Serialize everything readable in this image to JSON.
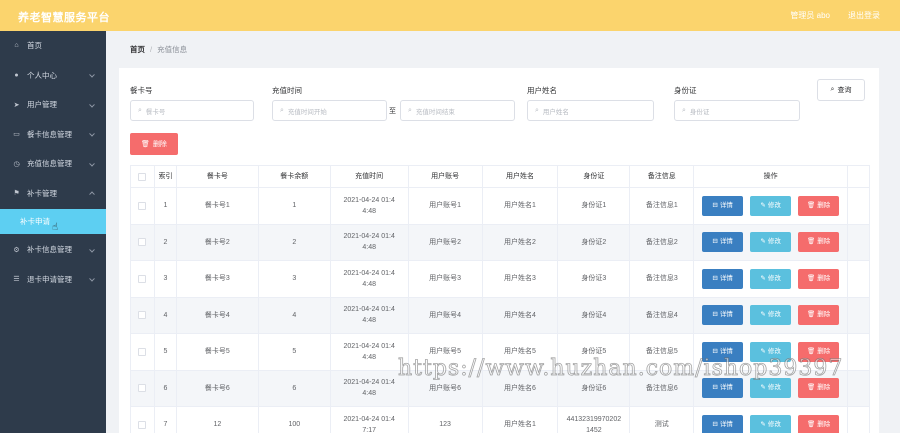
{
  "app": {
    "title": "养老智慧服务平台",
    "admin_label": "管理员 abo",
    "logout_label": "退出登录"
  },
  "sidebar": {
    "items": [
      {
        "label": "首页",
        "icon": "home-icon",
        "has_arrow": false
      },
      {
        "label": "个人中心",
        "icon": "user-icon",
        "has_arrow": true
      },
      {
        "label": "用户管理",
        "icon": "send-icon",
        "has_arrow": true
      },
      {
        "label": "餐卡信息管理",
        "icon": "card-icon",
        "has_arrow": true
      },
      {
        "label": "充值信息管理",
        "icon": "clock-icon",
        "has_arrow": true
      },
      {
        "label": "补卡管理",
        "icon": "flag-icon",
        "has_arrow": true,
        "expanded": true
      },
      {
        "label": "补卡信息管理",
        "icon": "gear-icon",
        "has_arrow": true
      },
      {
        "label": "退卡申请管理",
        "icon": "sliders-icon",
        "has_arrow": true
      }
    ],
    "active_subitem": "补卡申请"
  },
  "breadcrumb": {
    "home": "首页",
    "separator": "/",
    "current": "充值信息"
  },
  "search": {
    "card_label": "餐卡号",
    "card_placeholder": "餐卡号",
    "time_label": "充值时间",
    "time_start_placeholder": "充值时间开始",
    "time_to": "至",
    "time_end_placeholder": "充值时间结束",
    "name_label": "用户姓名",
    "name_placeholder": "用户姓名",
    "id_label": "身份证",
    "id_placeholder": "身份证",
    "query_label": "查询"
  },
  "actions": {
    "delete_label": "删除"
  },
  "table": {
    "headers": [
      "索引",
      "餐卡号",
      "餐卡余额",
      "充值时间",
      "用户账号",
      "用户姓名",
      "身份证",
      "备注信息",
      "操作"
    ],
    "rows": [
      {
        "index": "1",
        "card": "餐卡号1",
        "balance": "1",
        "time1": "2021-04-24 01:4",
        "time2": "4:48",
        "account": "用户账号1",
        "name": "用户姓名1",
        "id1": "身份证1",
        "id2": "",
        "note": "备注信息1"
      },
      {
        "index": "2",
        "card": "餐卡号2",
        "balance": "2",
        "time1": "2021-04-24 01:4",
        "time2": "4:48",
        "account": "用户账号2",
        "name": "用户姓名2",
        "id1": "身份证2",
        "id2": "",
        "note": "备注信息2"
      },
      {
        "index": "3",
        "card": "餐卡号3",
        "balance": "3",
        "time1": "2021-04-24 01:4",
        "time2": "4:48",
        "account": "用户账号3",
        "name": "用户姓名3",
        "id1": "身份证3",
        "id2": "",
        "note": "备注信息3"
      },
      {
        "index": "4",
        "card": "餐卡号4",
        "balance": "4",
        "time1": "2021-04-24 01:4",
        "time2": "4:48",
        "account": "用户账号4",
        "name": "用户姓名4",
        "id1": "身份证4",
        "id2": "",
        "note": "备注信息4"
      },
      {
        "index": "5",
        "card": "餐卡号5",
        "balance": "5",
        "time1": "2021-04-24 01:4",
        "time2": "4:48",
        "account": "用户账号5",
        "name": "用户姓名5",
        "id1": "身份证5",
        "id2": "",
        "note": "备注信息5"
      },
      {
        "index": "6",
        "card": "餐卡号6",
        "balance": "6",
        "time1": "2021-04-24 01:4",
        "time2": "4:48",
        "account": "用户账号6",
        "name": "用户姓名6",
        "id1": "身份证6",
        "id2": "",
        "note": "备注信息6"
      },
      {
        "index": "7",
        "card": "12",
        "balance": "100",
        "time1": "2021-04-24 01:4",
        "time2": "7:17",
        "account": "123",
        "name": "用户姓名1",
        "id1": "44132319970202",
        "id2": "1452",
        "note": "测试"
      }
    ],
    "row_actions": {
      "detail": "详情",
      "edit": "修改",
      "delete": "删除"
    }
  },
  "watermark": "https://www.huzhan.com/ishop39397",
  "colors": {
    "topbar": "#fbd46d",
    "sidebar": "#2e3b4b",
    "active_subitem": "#5dcff2",
    "detail_button": "#3a7fc1",
    "edit_button": "#5bc0de",
    "delete_button": "#f56c6c"
  }
}
